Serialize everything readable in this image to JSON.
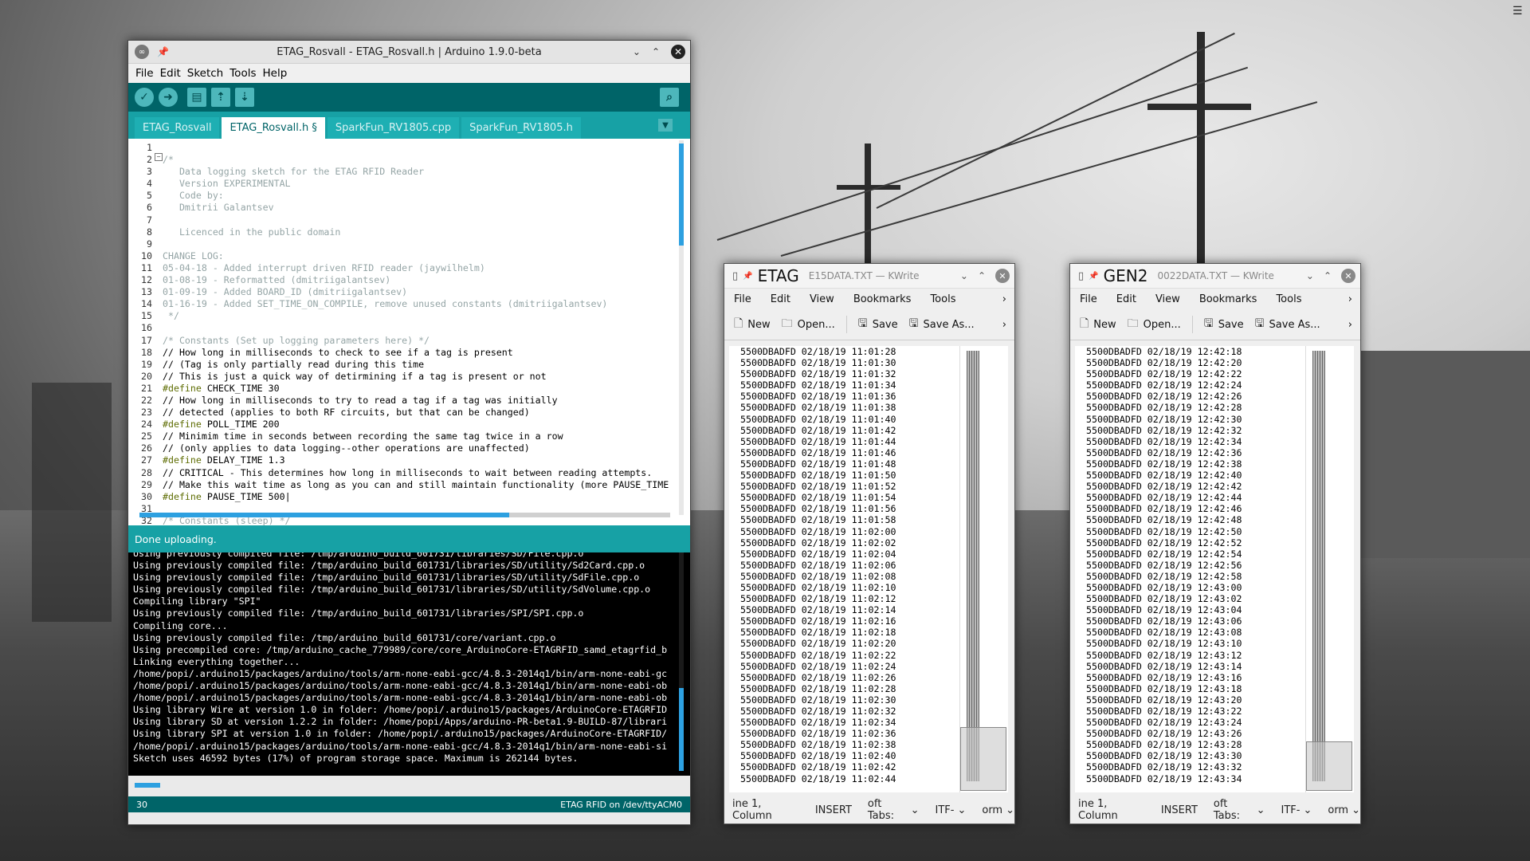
{
  "desktop": {
    "menu_icon": "hamburger-icon"
  },
  "arduino": {
    "title": "ETAG_Rosvall - ETAG_Rosvall.h | Arduino 1.9.0-beta",
    "menu": [
      "File",
      "Edit",
      "Sketch",
      "Tools",
      "Help"
    ],
    "toolbar_icons": [
      "verify-icon",
      "upload-icon",
      "new-icon",
      "open-icon",
      "save-icon",
      "serial-monitor-icon"
    ],
    "tabs": [
      "ETAG_Rosvall",
      "ETAG_Rosvall.h §",
      "SparkFun_RV1805.cpp",
      "SparkFun_RV1805.h"
    ],
    "active_tab": 1,
    "code_lines": [
      {
        "n": "1",
        "t": "",
        "c": ""
      },
      {
        "n": "2",
        "t": "/*",
        "c": "cm"
      },
      {
        "n": "3",
        "t": "   Data logging sketch for the ETAG RFID Reader",
        "c": "cm"
      },
      {
        "n": "4",
        "t": "   Version EXPERIMENTAL",
        "c": "cm"
      },
      {
        "n": "5",
        "t": "   Code by:",
        "c": "cm"
      },
      {
        "n": "6",
        "t": "   Dmitrii Galantsev",
        "c": "cm"
      },
      {
        "n": "7",
        "t": "",
        "c": "cm"
      },
      {
        "n": "8",
        "t": "   Licenced in the public domain",
        "c": "cm"
      },
      {
        "n": "9",
        "t": "",
        "c": "cm"
      },
      {
        "n": "10",
        "t": "CHANGE LOG:",
        "c": "cm"
      },
      {
        "n": "11",
        "t": "05-04-18 - Added interrupt driven RFID reader (jaywilhelm)",
        "c": "cm"
      },
      {
        "n": "12",
        "t": "01-08-19 - Reformatted (dmitriigalantsev)",
        "c": "cm"
      },
      {
        "n": "13",
        "t": "01-09-19 - Added BOARD_ID (dmitriigalantsev)",
        "c": "cm"
      },
      {
        "n": "14",
        "t": "01-16-19 - Added SET_TIME_ON_COMPILE, remove unused constants (dmitriigalantsev)",
        "c": "cm"
      },
      {
        "n": "15",
        "t": " */",
        "c": "cm"
      },
      {
        "n": "16",
        "t": "",
        "c": ""
      },
      {
        "n": "17",
        "t": "/* Constants (Set up logging parameters here) */",
        "c": "cm"
      },
      {
        "n": "18",
        "t": "// How long in milliseconds to check to see if a tag is present",
        "c": ""
      },
      {
        "n": "19",
        "t": "// (Tag is only partially read during this time",
        "c": ""
      },
      {
        "n": "20",
        "t": "// This is just a quick way of detirmining if a tag is present or not",
        "c": ""
      },
      {
        "n": "21",
        "t": "#define CHECK_TIME 30",
        "c": "def"
      },
      {
        "n": "22",
        "t": "// How long in milliseconds to try to read a tag if a tag was initially",
        "c": ""
      },
      {
        "n": "23",
        "t": "// detected (applies to both RF circuits, but that can be changed)",
        "c": ""
      },
      {
        "n": "24",
        "t": "#define POLL_TIME 200",
        "c": "def"
      },
      {
        "n": "25",
        "t": "// Minimim time in seconds between recording the same tag twice in a row",
        "c": ""
      },
      {
        "n": "26",
        "t": "// (only applies to data logging--other operations are unaffected)",
        "c": ""
      },
      {
        "n": "27",
        "t": "#define DELAY_TIME 1.3",
        "c": "def"
      },
      {
        "n": "28",
        "t": "// CRITICAL - This determines how long in milliseconds to wait between reading attempts.",
        "c": ""
      },
      {
        "n": "29",
        "t": "// Make this wait time as long as you can and still maintain functionality (more PAUSE_TIME",
        "c": ""
      },
      {
        "n": "30",
        "t": "#define PAUSE_TIME 500|",
        "c": "def"
      },
      {
        "n": "31",
        "t": "",
        "c": ""
      },
      {
        "n": "32",
        "t": "/* Constants (sleep) */",
        "c": "cm"
      }
    ],
    "status": "Done uploading.",
    "console_lines": [
      "Using previously compiled file: /tmp/arduino_build_601731/libraries/SD/File.cpp.o",
      "Using previously compiled file: /tmp/arduino_build_601731/libraries/SD/utility/Sd2Card.cpp.o",
      "Using previously compiled file: /tmp/arduino_build_601731/libraries/SD/utility/SdFile.cpp.o",
      "Using previously compiled file: /tmp/arduino_build_601731/libraries/SD/utility/SdVolume.cpp.o",
      "Compiling library \"SPI\"",
      "Using previously compiled file: /tmp/arduino_build_601731/libraries/SPI/SPI.cpp.o",
      "Compiling core...",
      "Using previously compiled file: /tmp/arduino_build_601731/core/variant.cpp.o",
      "Using precompiled core: /tmp/arduino_cache_779989/core/core_ArduinoCore-ETAGRFID_samd_etagrfid_b",
      "Linking everything together...",
      "/home/popi/.arduino15/packages/arduino/tools/arm-none-eabi-gcc/4.8.3-2014q1/bin/arm-none-eabi-gc",
      "/home/popi/.arduino15/packages/arduino/tools/arm-none-eabi-gcc/4.8.3-2014q1/bin/arm-none-eabi-ob",
      "/home/popi/.arduino15/packages/arduino/tools/arm-none-eabi-gcc/4.8.3-2014q1/bin/arm-none-eabi-ob",
      "Using library Wire at version 1.0 in folder: /home/popi/.arduino15/packages/ArduinoCore-ETAGRFID",
      "Using library SD at version 1.2.2 in folder: /home/popi/Apps/arduino-PR-beta1.9-BUILD-87/librari",
      "Using library SPI at version 1.0 in folder: /home/popi/.arduino15/packages/ArduinoCore-ETAGRFID/",
      "/home/popi/.arduino15/packages/arduino/tools/arm-none-eabi-gcc/4.8.3-2014q1/bin/arm-none-eabi-si",
      "Sketch uses 46592 bytes (17%) of program storage space. Maximum is 262144 bytes."
    ],
    "footer_line": "30",
    "footer_board": "ETAG RFID on /dev/ttyACM0"
  },
  "kwrite_etag": {
    "name": "ETAG",
    "subtitle": "E15DATA.TXT — KWrite",
    "menu": [
      "File",
      "Edit",
      "View",
      "Bookmarks",
      "Tools"
    ],
    "tools": {
      "new": "New",
      "open": "Open...",
      "save": "Save",
      "save_as": "Save As..."
    },
    "rows": [
      "5500DBADFD 02/18/19 11:01:28",
      "5500DBADFD 02/18/19 11:01:30",
      "5500DBADFD 02/18/19 11:01:32",
      "5500DBADFD 02/18/19 11:01:34",
      "5500DBADFD 02/18/19 11:01:36",
      "5500DBADFD 02/18/19 11:01:38",
      "5500DBADFD 02/18/19 11:01:40",
      "5500DBADFD 02/18/19 11:01:42",
      "5500DBADFD 02/18/19 11:01:44",
      "5500DBADFD 02/18/19 11:01:46",
      "5500DBADFD 02/18/19 11:01:48",
      "5500DBADFD 02/18/19 11:01:50",
      "5500DBADFD 02/18/19 11:01:52",
      "5500DBADFD 02/18/19 11:01:54",
      "5500DBADFD 02/18/19 11:01:56",
      "5500DBADFD 02/18/19 11:01:58",
      "5500DBADFD 02/18/19 11:02:00",
      "5500DBADFD 02/18/19 11:02:02",
      "5500DBADFD 02/18/19 11:02:04",
      "5500DBADFD 02/18/19 11:02:06",
      "5500DBADFD 02/18/19 11:02:08",
      "5500DBADFD 02/18/19 11:02:10",
      "5500DBADFD 02/18/19 11:02:12",
      "5500DBADFD 02/18/19 11:02:14",
      "5500DBADFD 02/18/19 11:02:16",
      "5500DBADFD 02/18/19 11:02:18",
      "5500DBADFD 02/18/19 11:02:20",
      "5500DBADFD 02/18/19 11:02:22",
      "5500DBADFD 02/18/19 11:02:24",
      "5500DBADFD 02/18/19 11:02:26",
      "5500DBADFD 02/18/19 11:02:28",
      "5500DBADFD 02/18/19 11:02:30",
      "5500DBADFD 02/18/19 11:02:32",
      "5500DBADFD 02/18/19 11:02:34",
      "5500DBADFD 02/18/19 11:02:36",
      "5500DBADFD 02/18/19 11:02:38",
      "5500DBADFD 02/18/19 11:02:40",
      "5500DBADFD 02/18/19 11:02:42",
      "5500DBADFD 02/18/19 11:02:44"
    ],
    "status": {
      "pos": "ine 1, Column",
      "mode": "INSERT",
      "tabs": "oft Tabs:",
      "enc": "ITF-",
      "fmt": "orm"
    }
  },
  "kwrite_gen2": {
    "name": "GEN2",
    "subtitle": "0022DATA.TXT — KWrite",
    "menu": [
      "File",
      "Edit",
      "View",
      "Bookmarks",
      "Tools"
    ],
    "tools": {
      "new": "New",
      "open": "Open...",
      "save": "Save",
      "save_as": "Save As..."
    },
    "rows": [
      "5500DBADFD 02/18/19 12:42:18",
      "5500DBADFD 02/18/19 12:42:20",
      "5500DBADFD 02/18/19 12:42:22",
      "5500DBADFD 02/18/19 12:42:24",
      "5500DBADFD 02/18/19 12:42:26",
      "5500DBADFD 02/18/19 12:42:28",
      "5500DBADFD 02/18/19 12:42:30",
      "5500DBADFD 02/18/19 12:42:32",
      "5500DBADFD 02/18/19 12:42:34",
      "5500DBADFD 02/18/19 12:42:36",
      "5500DBADFD 02/18/19 12:42:38",
      "5500DBADFD 02/18/19 12:42:40",
      "5500DBADFD 02/18/19 12:42:42",
      "5500DBADFD 02/18/19 12:42:44",
      "5500DBADFD 02/18/19 12:42:46",
      "5500DBADFD 02/18/19 12:42:48",
      "5500DBADFD 02/18/19 12:42:50",
      "5500DBADFD 02/18/19 12:42:52",
      "5500DBADFD 02/18/19 12:42:54",
      "5500DBADFD 02/18/19 12:42:56",
      "5500DBADFD 02/18/19 12:42:58",
      "5500DBADFD 02/18/19 12:43:00",
      "5500DBADFD 02/18/19 12:43:02",
      "5500DBADFD 02/18/19 12:43:04",
      "5500DBADFD 02/18/19 12:43:06",
      "5500DBADFD 02/18/19 12:43:08",
      "5500DBADFD 02/18/19 12:43:10",
      "5500DBADFD 02/18/19 12:43:12",
      "5500DBADFD 02/18/19 12:43:14",
      "5500DBADFD 02/18/19 12:43:16",
      "5500DBADFD 02/18/19 12:43:18",
      "5500DBADFD 02/18/19 12:43:20",
      "5500DBADFD 02/18/19 12:43:22",
      "5500DBADFD 02/18/19 12:43:24",
      "5500DBADFD 02/18/19 12:43:26",
      "5500DBADFD 02/18/19 12:43:28",
      "5500DBADFD 02/18/19 12:43:30",
      "5500DBADFD 02/18/19 12:43:32",
      "5500DBADFD 02/18/19 12:43:34"
    ],
    "status": {
      "pos": "ine 1, Column",
      "mode": "INSERT",
      "tabs": "oft Tabs:",
      "enc": "ITF-",
      "fmt": "orm"
    }
  }
}
